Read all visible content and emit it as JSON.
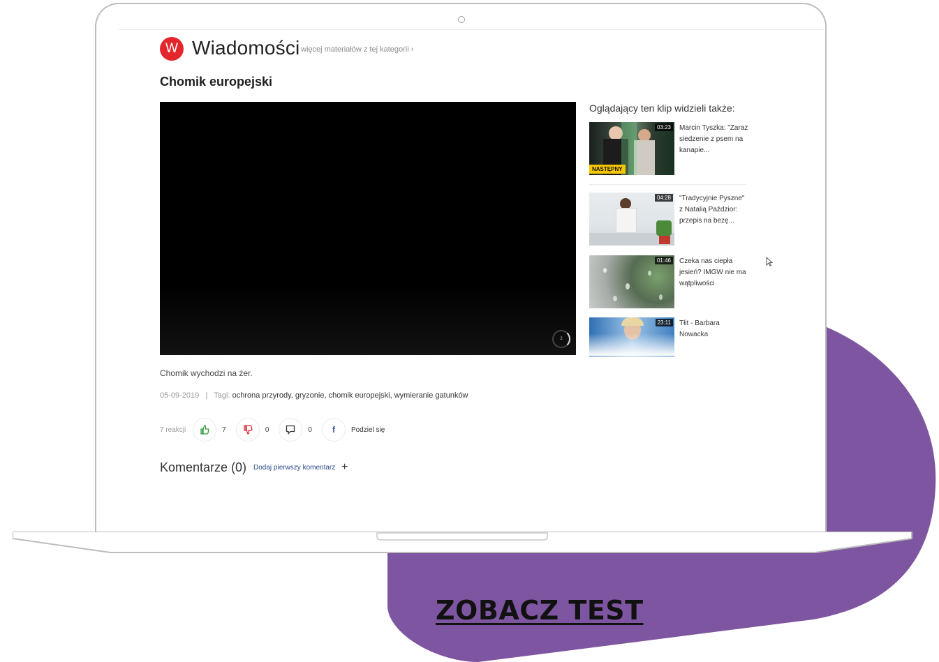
{
  "header": {
    "logo_letter": "W",
    "section_title": "Wiadomości",
    "more_link": "więcej materiałów z tej kategorii ›"
  },
  "article": {
    "title": "Chomik europejski",
    "description": "Chomik wychodzi na żer.",
    "date": "05-09-2019",
    "separator": "|",
    "tags_label": "Tagi:",
    "tags": "ochrona przyrody, gryzonie, chomik europejski, wymieranie gatunków"
  },
  "player": {
    "spinner_value": "2"
  },
  "reactions": {
    "count_label": "7 reakcji",
    "likes": "7",
    "dislikes": "0",
    "comments": "0",
    "share_label": "Podziel się"
  },
  "comments": {
    "title": "Komentarze (0)",
    "add_label": "Dodaj pierwszy komentarz",
    "plus": "+"
  },
  "sidebar": {
    "title": "Oglądający ten klip widzieli także:",
    "items": [
      {
        "duration": "03:23",
        "badge": "NASTĘPNY",
        "title": "Marcin Tyszka: \"Zaraz siedzenie z psem na kanapie..."
      },
      {
        "duration": "04:28",
        "badge": "",
        "title": "\"Tradycyjnie Pyszne\" z Natalią Paździor: przepis na bezę..."
      },
      {
        "duration": "01:46",
        "badge": "",
        "title": "Czeka nas ciepła jesień? IMGW nie ma wątpliwości"
      },
      {
        "duration": "23:11",
        "badge": "",
        "title": "Tłit - Barbara Nowacka"
      }
    ]
  },
  "cta": {
    "label": "ZOBACZ TEST"
  },
  "colors": {
    "brand_red": "#e3262b",
    "accent_purple": "#7e55a0",
    "badge_yellow": "#f6c700"
  }
}
